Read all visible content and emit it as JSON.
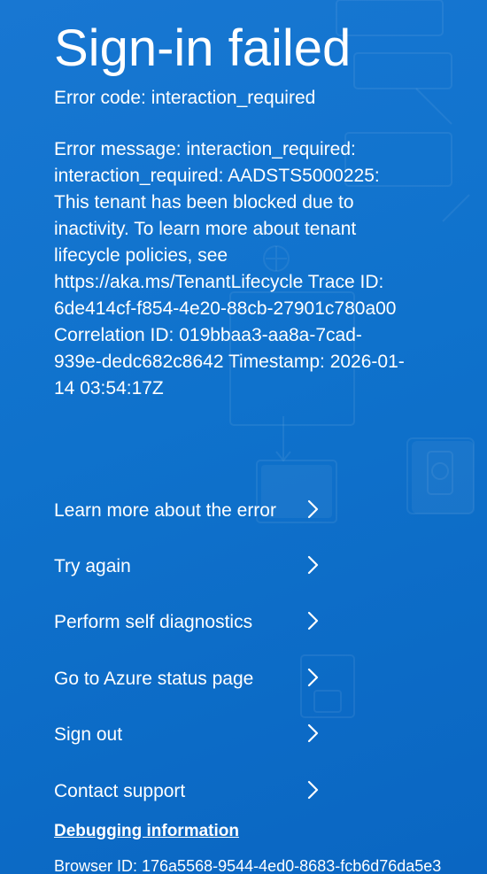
{
  "page": {
    "title": "Sign-in failed",
    "error_code": "Error code: interaction_required",
    "error_message": "Error message: interaction_required: interaction_required: AADSTS5000225: This tenant has been blocked due to inactivity. To learn more about tenant lifecycle policies, see https://aka.ms/TenantLifecycle Trace ID: 6de414cf-f854-4e20-88cb-27901c780a00 Correlation ID: 019bbaa3-aa8a-7cad-939e-dedc682c8642 Timestamp: 2026-01-14 03:54:17Z"
  },
  "actions": [
    {
      "label": "Learn more about the error",
      "icon": "chevron-right-icon"
    },
    {
      "label": "Try again",
      "icon": "chevron-right-icon"
    },
    {
      "label": "Perform self diagnostics",
      "icon": "chevron-right-icon"
    },
    {
      "label": "Go to Azure status page",
      "icon": "chevron-right-icon"
    },
    {
      "label": "Sign out",
      "icon": "chevron-right-icon"
    },
    {
      "label": "Contact support",
      "icon": "chevron-right-icon"
    }
  ],
  "debug": {
    "link_label": "Debugging information",
    "browser_id": "Browser ID: 176a5568-9544-4ed0-8683-fcb6d76da5e3"
  },
  "theme": {
    "background": "#0f72cc",
    "text": "#ffffff"
  }
}
